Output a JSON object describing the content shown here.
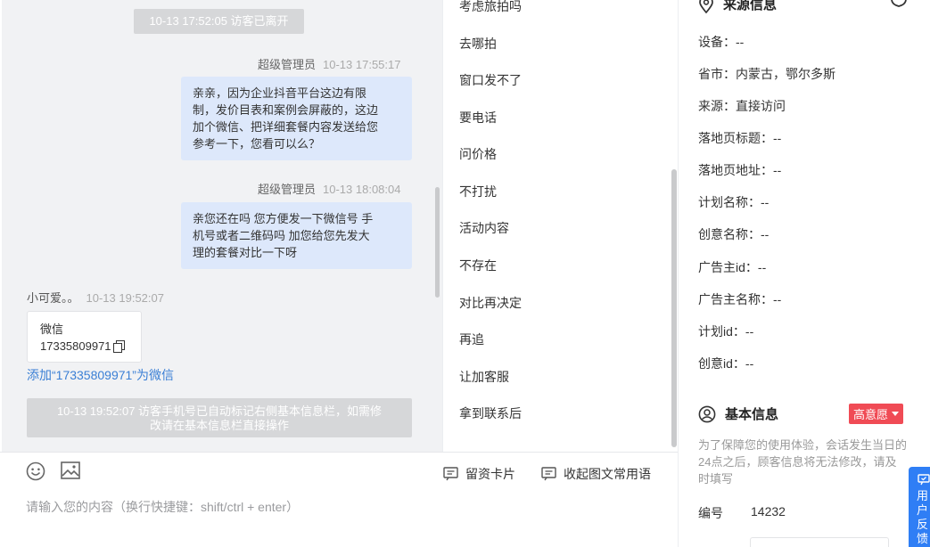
{
  "chat": {
    "system_left": "10-13 17:52:05 访客已离开",
    "msg1": {
      "sender": "超级管理员",
      "time": "10-13 17:55:17",
      "lines": [
        "亲亲，因为企业抖音平台这边有限",
        "制，发价目表和案例会屏蔽的，这边",
        "加个微信、把详细套餐内容发送给您",
        "参考一下，您看可以么？"
      ]
    },
    "msg2": {
      "sender": "超级管理员",
      "time": "10-13 18:08:04",
      "lines": [
        "亲您还在吗 您方便发一下微信号 手",
        "机号或者二维码吗 加您给您先发大",
        "理的套餐对比一下呀"
      ]
    },
    "msg3": {
      "sender": "小可爱。。",
      "time": "10-13 19:52:07"
    },
    "wechat_card": {
      "title": "微信",
      "number": "17335809971"
    },
    "add_link": "添加“17335809971”为微信",
    "system_auto": [
      "10-13 19:52:07 访客手机号已自动标记右侧基本信息栏，如需修",
      "改请在基本信息栏直接操作"
    ]
  },
  "phrases": [
    "考虑旅拍吗",
    "去哪拍",
    "窗口发不了",
    "要电话",
    "问价格",
    "不打扰",
    "活动内容",
    "不存在",
    "对比再决定",
    "再追",
    "让加客服",
    "拿到联系后"
  ],
  "input": {
    "placeholder": "请输入您的内容（换行快捷键：shift/ctrl + enter）",
    "card_label": "留资卡片",
    "collapse_label": "收起图文常用语",
    "emoji_icon": "smile-icon",
    "image_icon": "image-icon"
  },
  "info": {
    "source_title": "来源信息",
    "rows": [
      {
        "label": "设备：",
        "value": "--"
      },
      {
        "label": "省市：",
        "value": "内蒙古，鄂尔多斯"
      },
      {
        "label": "来源：",
        "value": "直接访问"
      },
      {
        "label": "落地页标题：",
        "value": "--"
      },
      {
        "label": "落地页地址：",
        "value": "--"
      },
      {
        "label": "计划名称：",
        "value": "--"
      },
      {
        "label": "创意名称：",
        "value": "--"
      },
      {
        "label": "广告主id：",
        "value": "--"
      },
      {
        "label": "广告主名称：",
        "value": "--"
      },
      {
        "label": "计划id：",
        "value": "--"
      },
      {
        "label": "创意id：",
        "value": "--"
      }
    ],
    "basic_title": "基本信息",
    "intent_badge": "高意愿",
    "intent_color": "#f04b55",
    "hint": "为了保障您的使用体验，会话发生当日的24点之后，顾客信息将无法修改，请及时填写",
    "id_label": "编号",
    "id_value": "14232"
  },
  "feedback": {
    "chars": [
      "用",
      "户",
      "反",
      "馈"
    ],
    "color": "#2f7ef5"
  }
}
